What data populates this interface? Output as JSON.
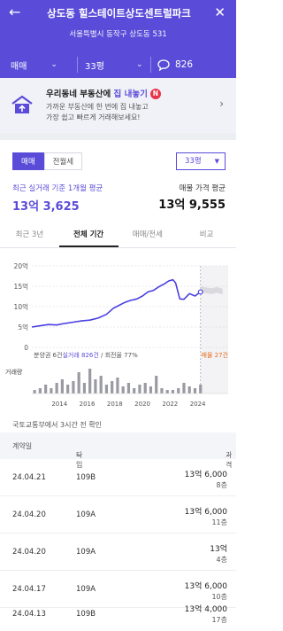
{
  "header": {
    "title": "상도동 힐스테이트상도센트럴파크",
    "address": "서울특별시 동작구 상도동 531",
    "deal_filter": "매매",
    "area_filter": "33평",
    "chat_count": "826"
  },
  "promo": {
    "headline_prefix": "우리동네 부동산에 ",
    "headline_highlight": "집 내놓기",
    "badge": "N",
    "desc_line1": "가까운 부동산에 한 번에 집 내놓고",
    "desc_line2": "가장 쉽고 빠르게 거래해보세요!"
  },
  "trade_toggle": [
    "매매",
    "전월세"
  ],
  "area_select": "33평",
  "summary": {
    "recent_label": "최근 실거래 기준 1개월 평균",
    "recent_value": "13억 3,625",
    "listing_label": "매물 가격 평균",
    "listing_value": "13억 9,555"
  },
  "period_tabs": [
    "최근 3년",
    "전체 기간",
    "매매/전세",
    "비교"
  ],
  "chart_data": {
    "type": "line",
    "y_ticks": [
      "20억",
      "15억",
      "10억",
      "5억",
      "0"
    ],
    "ylim": [
      0,
      20
    ],
    "x_ticks": [
      "2014",
      "2016",
      "2018",
      "2020",
      "2022",
      "2024"
    ],
    "xlim": [
      2012.0,
      2026.2
    ],
    "series": [
      {
        "name": "실거래",
        "x": [
          2012.0,
          2012.6,
          2013.2,
          2013.8,
          2014.4,
          2015.0,
          2015.6,
          2016.2,
          2016.8,
          2017.4,
          2017.9,
          2018.3,
          2018.7,
          2019.1,
          2019.6,
          2020.0,
          2020.4,
          2020.8,
          2021.2,
          2021.6,
          2021.9,
          2022.2,
          2022.4,
          2022.7,
          2023.0,
          2023.4,
          2023.8,
          2024.2
        ],
        "values": [
          5.0,
          5.3,
          5.6,
          5.5,
          5.9,
          6.2,
          6.5,
          6.7,
          7.2,
          8.1,
          9.6,
          10.3,
          11.0,
          11.5,
          11.9,
          12.6,
          13.6,
          14.0,
          14.9,
          15.6,
          16.3,
          16.6,
          15.8,
          11.9,
          11.8,
          13.2,
          12.6,
          13.6
        ]
      },
      {
        "name": "매물",
        "x": [
          2024.2,
          2024.6,
          2025.0,
          2025.4,
          2025.8
        ],
        "values": [
          14.3,
          14.0,
          13.8,
          14.1,
          13.7
        ]
      }
    ],
    "volume": {
      "x": [
        2012.2,
        2012.6,
        2013.0,
        2013.4,
        2013.8,
        2014.2,
        2014.6,
        2015.0,
        2015.4,
        2015.8,
        2016.2,
        2016.6,
        2017.0,
        2017.4,
        2017.8,
        2018.2,
        2018.6,
        2019.0,
        2019.4,
        2019.8,
        2020.2,
        2020.6,
        2021.0,
        2021.4,
        2021.8,
        2022.2,
        2022.6,
        2023.0,
        2023.4,
        2023.8,
        2024.2
      ],
      "values": [
        2,
        3,
        5,
        3,
        6,
        8,
        5,
        7,
        12,
        6,
        14,
        8,
        10,
        5,
        7,
        9,
        4,
        6,
        3,
        5,
        6,
        4,
        10,
        3,
        2,
        2,
        3,
        6,
        4,
        3,
        5
      ]
    },
    "stats_line": {
      "prefix": "분양권 6건",
      "highlight": "실거래 826건",
      "suffix": " / 회전율 77%",
      "listing": "매물 27건"
    },
    "volume_label": "거래량"
  },
  "source_note": "국토교통부에서 3시간 전 확인",
  "table": {
    "headers": [
      "계약일",
      "타입",
      "가격"
    ],
    "rows": [
      {
        "date": "24.04.21",
        "type": "109B",
        "price": "13억 6,000",
        "floor": "8층"
      },
      {
        "date": "24.04.20",
        "type": "109A",
        "price": "13억 6,000",
        "floor": "11층"
      },
      {
        "date": "24.04.20",
        "type": "109A",
        "price": "13억",
        "floor": "4층"
      },
      {
        "date": "24.04.17",
        "type": "109A",
        "price": "13억 6,000",
        "floor": "10층"
      },
      {
        "date": "24.04.13",
        "type": "109B",
        "price": "13억 4,000",
        "floor": "17층"
      }
    ]
  },
  "colors": {
    "brand": "#5a4cd8",
    "line": "#4a3fe0",
    "badge": "#e8344a",
    "listing_band": "#d9d9de",
    "listing_text": "#e86a1e"
  }
}
